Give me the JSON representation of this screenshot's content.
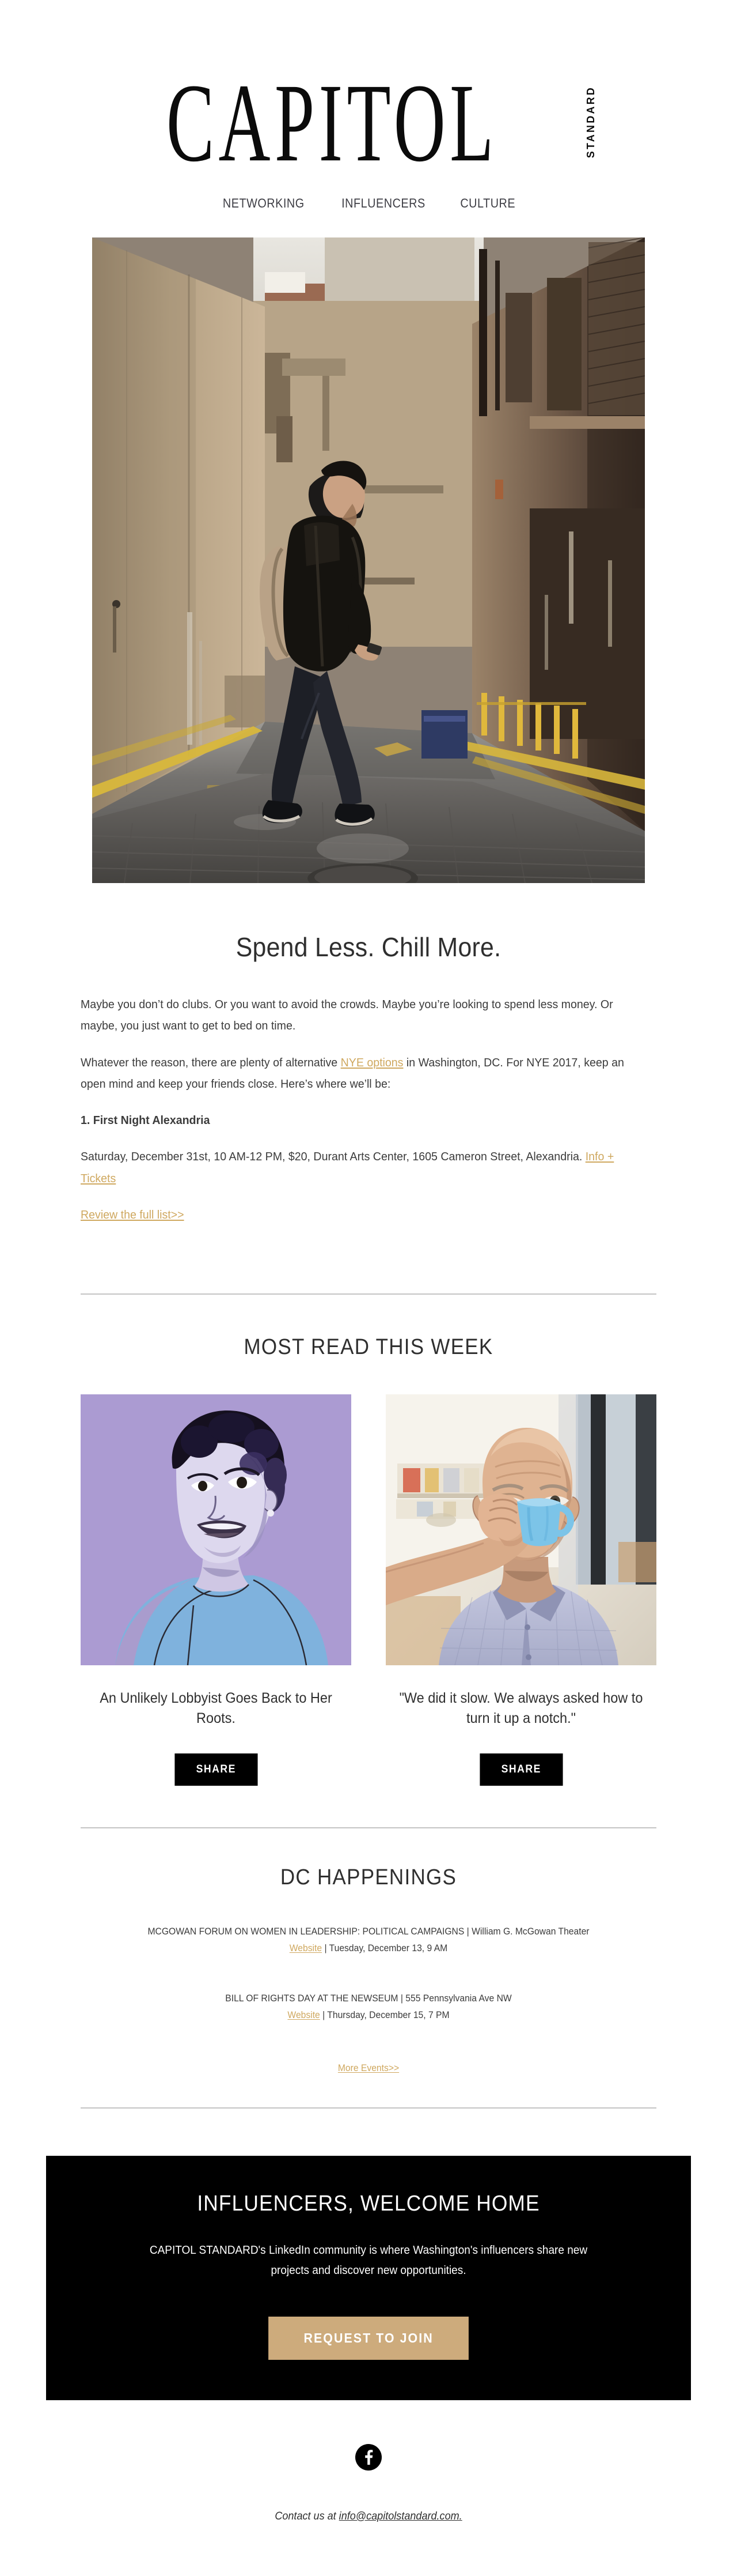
{
  "brand": {
    "wordmark": "CAPITOL",
    "wordmark_sub": "STANDARD"
  },
  "nav": {
    "items": [
      {
        "label": "NETWORKING"
      },
      {
        "label": "INFLUENCERS"
      },
      {
        "label": "CULTURE"
      }
    ]
  },
  "hero": {
    "alt": "Man with backpack walking across a wet city alley crosswalk"
  },
  "article": {
    "headline": "Spend Less. Chill More.",
    "para1": "Maybe you don’t do clubs. Or you want to avoid the crowds. Maybe you’re looking to spend less money. Or maybe, you just want to get to bed on time.",
    "para2_before": "Whatever the reason, there are plenty of alternative ",
    "para2_link": "NYE options",
    "para2_after": " in Washington, DC. For NYE 2017, keep an open mind and keep your friends close. Here’s where we’ll be:",
    "item_heading": "1. First Night Alexandria",
    "item_detail_before": "Saturday, December 31st, 10 AM-12 PM, $20, Durant Arts Center, 1605 Cameron Street, Alexandria. ",
    "item_detail_link": "Info + Tickets",
    "full_list_link": "Review the full list>>"
  },
  "most_read": {
    "title": "MOST READ THIS WEEK",
    "cards": [
      {
        "title": "An Unlikely Lobbyist Goes Back to Her Roots.",
        "share_label": "SHARE",
        "image_alt": "Illustrated portrait of a smiling woman on a lavender background"
      },
      {
        "title": "\"We did it slow. We always asked how to turn it up a notch.\"",
        "share_label": "SHARE",
        "image_alt": "Older man drinking from a blue mug in a bright room"
      }
    ]
  },
  "happenings": {
    "title": "DC HAPPENINGS",
    "events": [
      {
        "name_venue": "MCGOWAN FORUM ON WOMEN IN LEADERSHIP: POLITICAL CAMPAIGNS | William G. McGowan Theater",
        "website_label": "Website",
        "separator": " | ",
        "datetime": "Tuesday, December 13, 9 AM"
      },
      {
        "name_venue": "BILL OF RIGHTS DAY AT THE NEWSEUM | 555 Pennsylvania Ave NW",
        "website_label": "Website",
        "separator": " | ",
        "datetime": "Thursday, December 15, 7 PM"
      }
    ],
    "more_link": "More Events>>"
  },
  "promo": {
    "title": "INFLUENCERS, WELCOME HOME",
    "body": "CAPITOL STANDARD's LinkedIn community is where Washington's influencers share new projects and discover new opportunities.",
    "button_label": "REQUEST TO JOIN"
  },
  "footer": {
    "facebook_icon": "facebook-icon",
    "contact_prefix": "Contact us at ",
    "contact_email": "info@capitolstandard.com."
  },
  "colors": {
    "accent_gold": "#cfa85f",
    "promo_button": "#cdab7c",
    "banner_bg": "#000000",
    "divider": "#c4c4c4",
    "text": "#3b3b3b"
  }
}
